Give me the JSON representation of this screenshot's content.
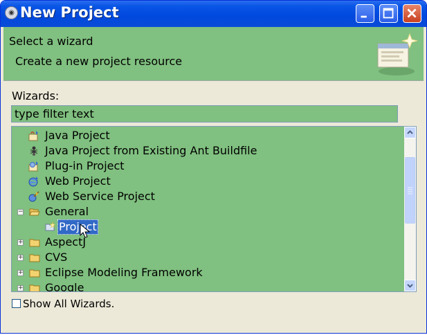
{
  "window": {
    "title": "New Project",
    "app_icon": "eclipse-icon",
    "controls": [
      "minimize",
      "maximize",
      "close"
    ]
  },
  "header": {
    "heading": "Select a wizard",
    "description": "Create a new project resource",
    "graphic": "wizard-banner-graphic"
  },
  "wizards": {
    "label": "Wizards:",
    "filter_value": "type filter text",
    "tree": [
      {
        "label": "Java Project",
        "icon": "java-project-icon",
        "level": 1
      },
      {
        "label": "Java Project from Existing Ant Buildfile",
        "icon": "ant-icon",
        "level": 1
      },
      {
        "label": "Plug-in Project",
        "icon": "plugin-project-icon",
        "level": 1
      },
      {
        "label": "Web Project",
        "icon": "web-project-icon",
        "level": 1
      },
      {
        "label": "Web Service Project",
        "icon": "web-service-icon",
        "level": 1
      },
      {
        "label": "General",
        "icon": "folder-open-icon",
        "level": 0,
        "expander": "−"
      },
      {
        "label": "Project",
        "icon": "project-icon",
        "level": 1,
        "selected": true
      },
      {
        "label": "AspectJ",
        "icon": "folder-icon",
        "level": 0,
        "expander": "+"
      },
      {
        "label": "CVS",
        "icon": "folder-icon",
        "level": 0,
        "expander": "+"
      },
      {
        "label": "Eclipse Modeling Framework",
        "icon": "folder-icon",
        "level": 0,
        "expander": "+"
      },
      {
        "label": "Google",
        "icon": "folder-icon",
        "level": 0,
        "expander": "+"
      }
    ]
  },
  "options": {
    "show_all_label": "Show All Wizards.",
    "show_all_checked": false
  },
  "colors": {
    "panel_green": "#80c080",
    "title_blue": "#0a56e6",
    "selection": "#3169c6"
  }
}
